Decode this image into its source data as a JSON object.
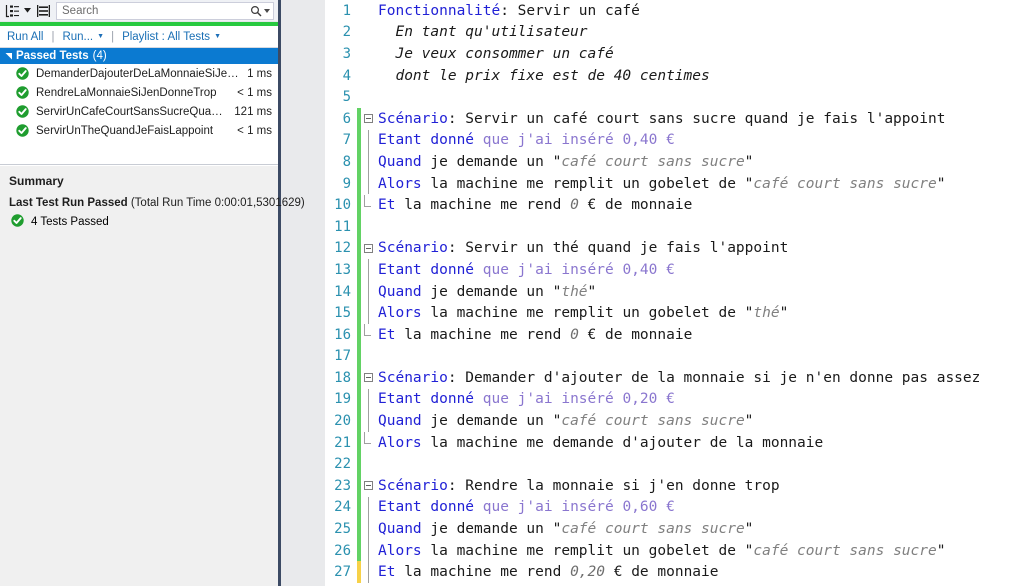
{
  "test_explorer": {
    "toolbar": {
      "group_by_icon": "group-by-icon",
      "group_by_caret": "chevron-down-icon",
      "list_settings_icon": "list-settings-icon",
      "search_placeholder": "Search",
      "search_value": "",
      "search_icon": "search-magnifier-icon",
      "search_caret": "chevron-down-icon"
    },
    "commands": {
      "run_all": "Run All",
      "run": "Run...",
      "playlist": "Playlist : All Tests",
      "separator": "|"
    },
    "group": {
      "label": "Passed Tests",
      "count": "(4)",
      "expander_icon": "triangle-expanded-icon",
      "selected": true
    },
    "tests": [
      {
        "name": "DemanderDajouterDeLaMonnaieSiJeNenDo...",
        "duration": "1 ms",
        "status_icon": "passed-check-icon"
      },
      {
        "name": "RendreLaMonnaieSiJenDonneTrop",
        "duration": "< 1 ms",
        "status_icon": "passed-check-icon"
      },
      {
        "name": "ServirUnCafeCourtSansSucreQuandJeFaisL...",
        "duration": "121 ms",
        "status_icon": "passed-check-icon"
      },
      {
        "name": "ServirUnTheQuandJeFaisLappoint",
        "duration": "< 1 ms",
        "status_icon": "passed-check-icon"
      }
    ],
    "summary": {
      "title": "Summary",
      "headline": "Last Test Run Passed",
      "run_time": " (Total Run Time 0:00:01,5301629)",
      "passed_count": "4 Tests Passed",
      "passed_icon": "passed-check-icon"
    }
  },
  "colors": {
    "accent_blue": "#0b7ad1",
    "pass_green": "#1f9d2f",
    "progress_green": "#27c93f",
    "change_green": "#62d264",
    "change_yellow": "#f7d148",
    "keyword_blue": "#2121d6",
    "narrative_purple": "#8a76cf",
    "string_gray": "#808080",
    "line_number": "#2b91af",
    "panel_border": "#3c4a64"
  },
  "editor": {
    "lines": [
      {
        "n": "1",
        "marker": "none",
        "glyph": "none",
        "tokens": [
          {
            "t": "Fonctionnalité",
            "c": "feat"
          },
          {
            "t": ": Servir un café",
            "c": "plain"
          }
        ]
      },
      {
        "n": "2",
        "marker": "none",
        "glyph": "none",
        "tokens": [
          {
            "t": "  En tant qu'utilisateur",
            "c": "ital"
          }
        ]
      },
      {
        "n": "3",
        "marker": "none",
        "glyph": "none",
        "tokens": [
          {
            "t": "  Je veux consommer un café",
            "c": "ital"
          }
        ]
      },
      {
        "n": "4",
        "marker": "none",
        "glyph": "none",
        "tokens": [
          {
            "t": "  dont le prix fixe est de 40 centimes",
            "c": "ital"
          }
        ]
      },
      {
        "n": "5",
        "marker": "none",
        "glyph": "none",
        "tokens": []
      },
      {
        "n": "6",
        "marker": "green",
        "glyph": "collapse",
        "tokens": [
          {
            "t": "Scénario",
            "c": "kw"
          },
          {
            "t": ": Servir un café court sans sucre quand je fais l'appoint",
            "c": "plain"
          }
        ]
      },
      {
        "n": "7",
        "marker": "green",
        "glyph": "vline",
        "tokens": [
          {
            "t": "Etant donné ",
            "c": "kw"
          },
          {
            "t": "que j'ai inséré 0,40 €",
            "c": "narr"
          }
        ]
      },
      {
        "n": "8",
        "marker": "green",
        "glyph": "vline",
        "tokens": [
          {
            "t": "Quand",
            "c": "kw"
          },
          {
            "t": " je demande un \"",
            "c": "plain"
          },
          {
            "t": "café court sans sucre",
            "c": "str"
          },
          {
            "t": "\"",
            "c": "plain"
          }
        ]
      },
      {
        "n": "9",
        "marker": "green",
        "glyph": "vline",
        "tokens": [
          {
            "t": "Alors",
            "c": "kw"
          },
          {
            "t": " la machine me remplit un gobelet de \"",
            "c": "plain"
          },
          {
            "t": "café court sans sucre",
            "c": "str"
          },
          {
            "t": "\"",
            "c": "plain"
          }
        ]
      },
      {
        "n": "10",
        "marker": "green",
        "glyph": "vline-end",
        "tokens": [
          {
            "t": "Et",
            "c": "kw"
          },
          {
            "t": " la machine me rend ",
            "c": "plain"
          },
          {
            "t": "0",
            "c": "num"
          },
          {
            "t": " € de monnaie",
            "c": "plain"
          }
        ]
      },
      {
        "n": "11",
        "marker": "green",
        "glyph": "none",
        "tokens": []
      },
      {
        "n": "12",
        "marker": "green",
        "glyph": "collapse",
        "tokens": [
          {
            "t": "Scénario",
            "c": "kw"
          },
          {
            "t": ": Servir un thé quand je fais l'appoint",
            "c": "plain"
          }
        ]
      },
      {
        "n": "13",
        "marker": "green",
        "glyph": "vline",
        "tokens": [
          {
            "t": "Etant donné ",
            "c": "kw"
          },
          {
            "t": "que j'ai inséré 0,40 €",
            "c": "narr"
          }
        ]
      },
      {
        "n": "14",
        "marker": "green",
        "glyph": "vline",
        "tokens": [
          {
            "t": "Quand",
            "c": "kw"
          },
          {
            "t": " je demande un \"",
            "c": "plain"
          },
          {
            "t": "thé",
            "c": "str"
          },
          {
            "t": "\"",
            "c": "plain"
          }
        ]
      },
      {
        "n": "15",
        "marker": "green",
        "glyph": "vline",
        "tokens": [
          {
            "t": "Alors",
            "c": "kw"
          },
          {
            "t": " la machine me remplit un gobelet de \"",
            "c": "plain"
          },
          {
            "t": "thé",
            "c": "str"
          },
          {
            "t": "\"",
            "c": "plain"
          }
        ]
      },
      {
        "n": "16",
        "marker": "green",
        "glyph": "vline-end",
        "tokens": [
          {
            "t": "Et",
            "c": "kw"
          },
          {
            "t": " la machine me rend ",
            "c": "plain"
          },
          {
            "t": "0",
            "c": "num"
          },
          {
            "t": " € de monnaie",
            "c": "plain"
          }
        ]
      },
      {
        "n": "17",
        "marker": "green",
        "glyph": "none",
        "tokens": []
      },
      {
        "n": "18",
        "marker": "green",
        "glyph": "collapse",
        "tokens": [
          {
            "t": "Scénario",
            "c": "kw"
          },
          {
            "t": ": Demander d'ajouter de la monnaie si je n'en donne pas assez",
            "c": "plain"
          }
        ]
      },
      {
        "n": "19",
        "marker": "green",
        "glyph": "vline",
        "tokens": [
          {
            "t": "Etant donné ",
            "c": "kw"
          },
          {
            "t": "que j'ai inséré 0,20 €",
            "c": "narr"
          }
        ]
      },
      {
        "n": "20",
        "marker": "green",
        "glyph": "vline",
        "tokens": [
          {
            "t": "Quand",
            "c": "kw"
          },
          {
            "t": " je demande un \"",
            "c": "plain"
          },
          {
            "t": "café court sans sucre",
            "c": "str"
          },
          {
            "t": "\"",
            "c": "plain"
          }
        ]
      },
      {
        "n": "21",
        "marker": "green",
        "glyph": "vline-end",
        "tokens": [
          {
            "t": "Alors",
            "c": "kw"
          },
          {
            "t": " la machine me demande d'ajouter de la monnaie",
            "c": "plain"
          }
        ]
      },
      {
        "n": "22",
        "marker": "green",
        "glyph": "none",
        "tokens": []
      },
      {
        "n": "23",
        "marker": "green",
        "glyph": "collapse",
        "tokens": [
          {
            "t": "Scénario",
            "c": "kw"
          },
          {
            "t": ": Rendre la monnaie si j'en donne trop",
            "c": "plain"
          }
        ]
      },
      {
        "n": "24",
        "marker": "green",
        "glyph": "vline",
        "tokens": [
          {
            "t": "Etant donné ",
            "c": "kw"
          },
          {
            "t": "que j'ai inséré 0,60 €",
            "c": "narr"
          }
        ]
      },
      {
        "n": "25",
        "marker": "green",
        "glyph": "vline",
        "tokens": [
          {
            "t": "Quand",
            "c": "kw"
          },
          {
            "t": " je demande un \"",
            "c": "plain"
          },
          {
            "t": "café court sans sucre",
            "c": "str"
          },
          {
            "t": "\"",
            "c": "plain"
          }
        ]
      },
      {
        "n": "26",
        "marker": "green",
        "glyph": "vline",
        "tokens": [
          {
            "t": "Alors",
            "c": "kw"
          },
          {
            "t": " la machine me remplit un gobelet de \"",
            "c": "plain"
          },
          {
            "t": "café court sans sucre",
            "c": "str"
          },
          {
            "t": "\"",
            "c": "plain"
          }
        ]
      },
      {
        "n": "27",
        "marker": "yellow",
        "glyph": "vline",
        "tokens": [
          {
            "t": "Et",
            "c": "kw"
          },
          {
            "t": " la machine me rend ",
            "c": "plain"
          },
          {
            "t": "0,20",
            "c": "num"
          },
          {
            "t": " € de monnaie",
            "c": "plain"
          }
        ]
      }
    ]
  }
}
